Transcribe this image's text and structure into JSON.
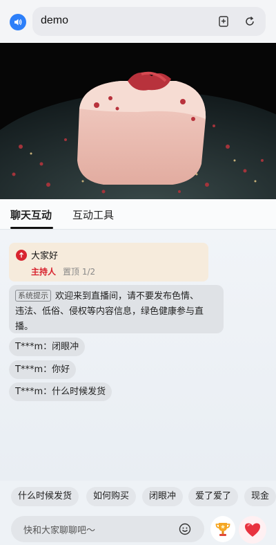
{
  "browser": {
    "url": "demo"
  },
  "tabs": [
    {
      "label": "聊天互动",
      "active": true
    },
    {
      "label": "互动工具",
      "active": false
    }
  ],
  "pinned": {
    "text": "大家好",
    "host_label": "主持人",
    "pin_count": "置顶 1/2"
  },
  "system_message": {
    "tag": "系统提示",
    "line1": "欢迎来到直播间，请不要发布色情、",
    "line2": "违法、低俗、侵权等内容信息，绿色健康参与直",
    "line3": "播。"
  },
  "messages": [
    {
      "text": "T***m：闭眼冲"
    },
    {
      "text": "T***m：你好"
    },
    {
      "text": "T***m：什么时候发货"
    }
  ],
  "quick_replies": [
    "什么时候发货",
    "如何购买",
    "闭眼冲",
    "爱了爱了",
    "现金"
  ],
  "input": {
    "placeholder": "快和大家聊聊吧～"
  },
  "colors": {
    "accent_blue": "#2d7ff9",
    "host_red": "#d8242f",
    "pinned_bg": "#f6ebdc"
  },
  "icons": {
    "left": "speaker-icon",
    "url_actions": [
      "bookmark-add-icon",
      "refresh-icon"
    ],
    "input": "emoji-icon",
    "actions": [
      "trophy-icon",
      "heart-icon"
    ]
  }
}
